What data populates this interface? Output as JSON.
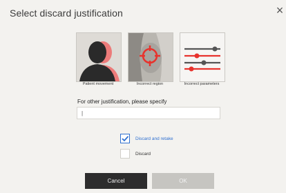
{
  "dialog": {
    "title": "Select discard justification",
    "close_glyph": "×",
    "close_icon": "close-icon"
  },
  "options": [
    {
      "label": "Patient movement",
      "icon": "patient-movement-icon",
      "accent": "#e8322c"
    },
    {
      "label": "Incorrect region",
      "icon": "incorrect-region-icon",
      "accent": "#e8322c"
    },
    {
      "label": "Incorrect parameters",
      "icon": "incorrect-parameters-icon",
      "accent": "#e8322c"
    }
  ],
  "other": {
    "label": "For other justification, please specify",
    "value": "|",
    "placeholder": ""
  },
  "checkboxes": [
    {
      "label": "Discard and retake",
      "checked": true,
      "color": "#2e6fd0"
    },
    {
      "label": "Discard",
      "checked": false,
      "color": "#333333"
    }
  ],
  "buttons": {
    "cancel": "Cancel",
    "ok": "OK"
  },
  "colors": {
    "accent_red": "#e8322c",
    "check_blue": "#2e6fd0",
    "cancel_bg": "#2d2d2d",
    "ok_disabled_bg": "#c6c5c1"
  }
}
